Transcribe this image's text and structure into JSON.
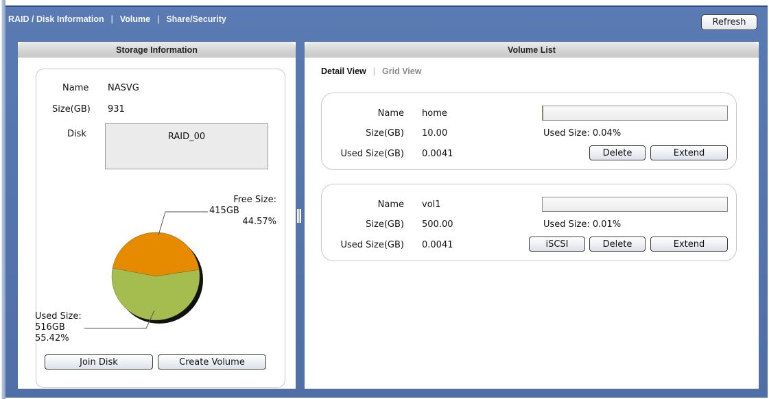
{
  "nav": {
    "items": [
      "RAID / Disk Information",
      "Volume",
      "Share/Security"
    ],
    "active_index": 1
  },
  "refresh_label": "Refresh",
  "storage": {
    "header": "Storage Information",
    "name_label": "Name",
    "name_value": "NASVG",
    "size_label": "Size(GB)",
    "size_value": "931",
    "disk_label": "Disk",
    "disk_value": "RAID_00",
    "free_label_line1": "Free Size:",
    "free_label_line2": "415GB",
    "free_label_line3": "44.57%",
    "used_label_line1": "Used Size:",
    "used_label_line2": "516GB",
    "used_label_line3": "55.42%",
    "join_disk_label": "Join Disk",
    "create_volume_label": "Create Volume"
  },
  "chart_data": {
    "type": "pie",
    "slices": [
      {
        "label": "Free Size",
        "value": 44.57,
        "size": "415GB",
        "color": "#e68a00"
      },
      {
        "label": "Used Size",
        "value": 55.42,
        "size": "516GB",
        "color": "#a5bd4e"
      }
    ]
  },
  "volume_list": {
    "header": "Volume List",
    "tab_detail": "Detail View",
    "tab_grid": "Grid View",
    "volumes": [
      {
        "name_label": "Name",
        "name": "home",
        "size_label": "Size(GB)",
        "size": "10.00",
        "used_label": "Used Size(GB)",
        "used": "0.0041",
        "used_pct_text": "Used Size: 0.04%",
        "used_fraction": 0.0004,
        "buttons": [
          "Delete",
          "Extend"
        ]
      },
      {
        "name_label": "Name",
        "name": "vol1",
        "size_label": "Size(GB)",
        "size": "500.00",
        "used_label": "Used Size(GB)",
        "used": "0.0041",
        "used_pct_text": "Used Size: 0.01%",
        "used_fraction": 0.0001,
        "buttons": [
          "iSCSI",
          "Delete",
          "Extend"
        ]
      }
    ]
  }
}
